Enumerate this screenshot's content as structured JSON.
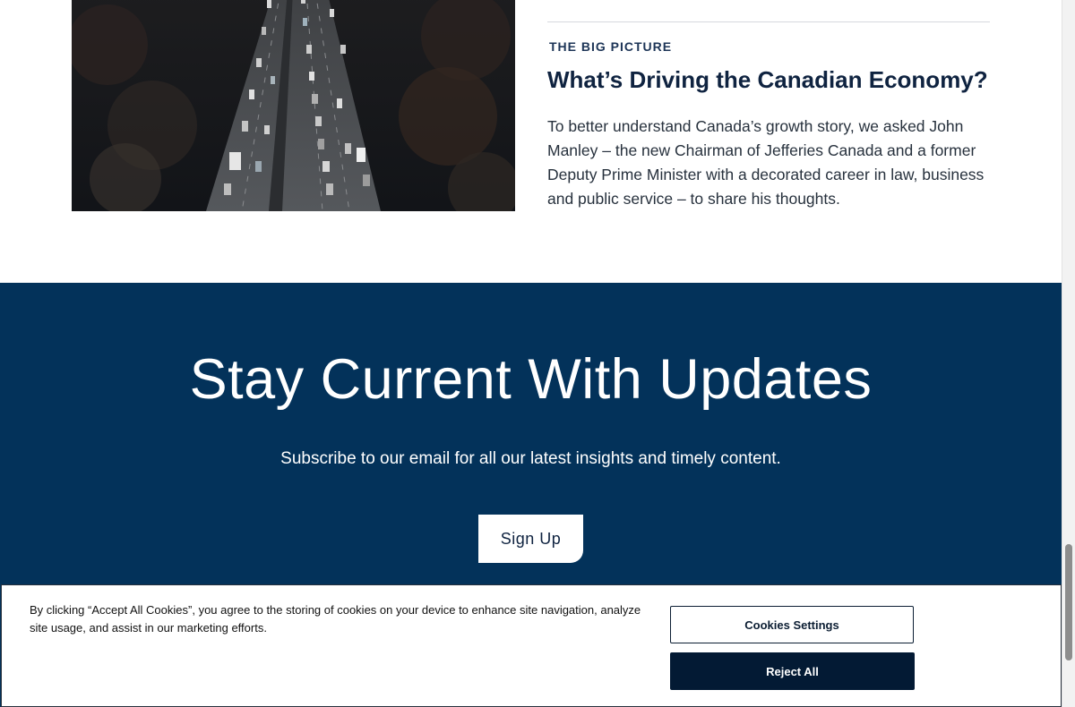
{
  "article": {
    "eyebrow": "THE BIG PICTURE",
    "headline": "What’s Driving the Canadian Economy?",
    "body": "To better understand Canada’s growth story, we asked John Manley – the new Chairman of Jefferies Canada and a former Deputy Prime Minister with a decorated career in law, business and public service – to share his thoughts.",
    "image_icon": "aerial-highway-photo"
  },
  "newsletter": {
    "title": "Stay Current With Updates",
    "subtitle": "Subscribe to our email for all our latest insights and timely content.",
    "signup_label": "Sign Up",
    "background_color": "#03325a"
  },
  "cookie_banner": {
    "text": "By clicking “Accept All Cookies”, you agree to the storing of cookies on your device to enhance site navigation, analyze site usage, and assist in our marketing efforts.",
    "settings_label": "Cookies Settings",
    "reject_label": "Reject All"
  }
}
